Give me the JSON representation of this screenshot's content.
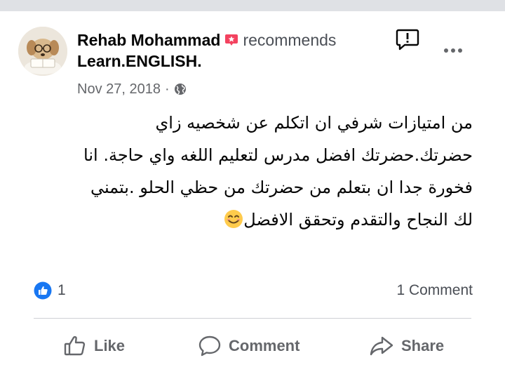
{
  "post": {
    "author": "Rehab Mohammad",
    "action": "recommends",
    "page": "Learn.ENGLISH.",
    "date": "Nov 27, 2018",
    "separator": "·",
    "text_lines": [
      "من امتيازات شرفي ان اتكلم عن شخصيه زاي",
      "حضرتك.حضرتك افضل مدرس لتعليم اللغه واي حاجة. انا",
      "فخورة جدا ان بتعلم من حضرتك من حظي الحلو .بتمني",
      "لك النجاح والتقدم وتحقق الافضل"
    ]
  },
  "stats": {
    "reaction_count": "1",
    "comment_count": "1 Comment"
  },
  "actions": {
    "like": "Like",
    "comment": "Comment",
    "share": "Share"
  },
  "icons": {
    "avatar": "avatar-puppy-reading",
    "recommend_badge": "recommend-badge-icon",
    "report": "report-icon",
    "more": "more-options-icon",
    "privacy": "globe-icon",
    "emoji": "smiling-face-emoji",
    "like_reaction": "like-reaction-icon"
  },
  "colors": {
    "text": "#050505",
    "secondary": "#65676b",
    "recommend": "#f3425f",
    "like_blue": "#1877f2",
    "divider": "#ced0d4"
  }
}
